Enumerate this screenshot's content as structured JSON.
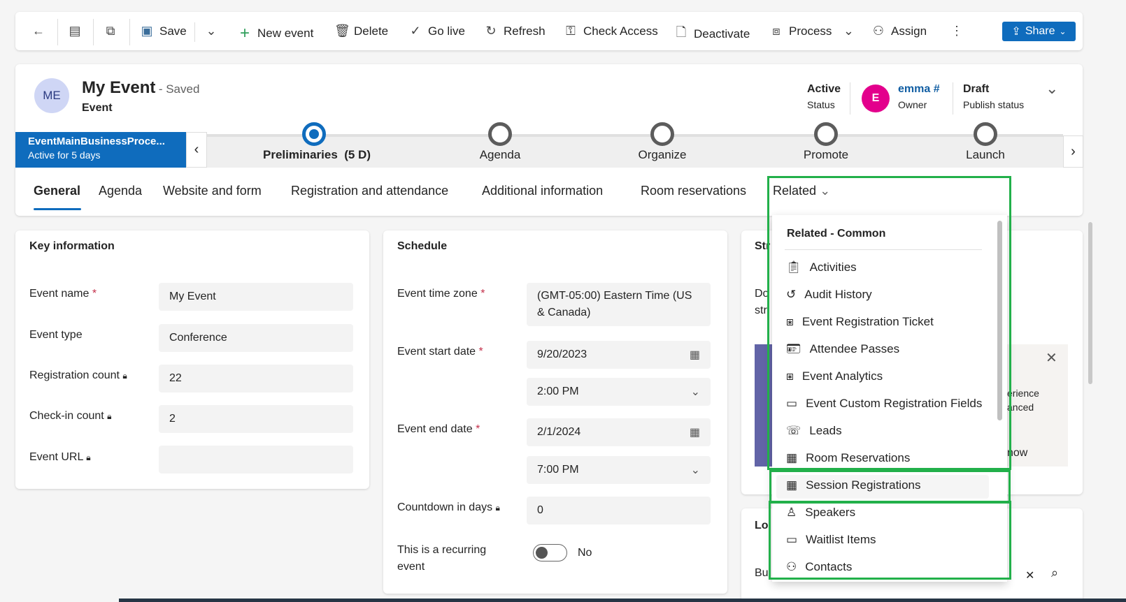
{
  "toolbar": {
    "save": "Save",
    "new_event": "New event",
    "delete": "Delete",
    "go_live": "Go live",
    "refresh": "Refresh",
    "check_access": "Check Access",
    "deactivate": "Deactivate",
    "process": "Process",
    "assign": "Assign",
    "share": "Share"
  },
  "header": {
    "avatar": "ME",
    "title": "My Event",
    "saved": "- Saved",
    "entity": "Event",
    "status_value": "Active",
    "status_label": "Status",
    "owner_avatar": "E",
    "owner_value": "emma #",
    "owner_label": "Owner",
    "publish_value": "Draft",
    "publish_label": "Publish status",
    "owner_color": "#e3008c"
  },
  "process": {
    "name": "EventMainBusinessProce...",
    "active": "Active for 5 days",
    "stages": [
      "Preliminaries  (5 D)",
      "Agenda",
      "Organize",
      "Promote",
      "Launch"
    ]
  },
  "tabs": [
    "General",
    "Agenda",
    "Website and form",
    "Registration and attendance",
    "Additional information",
    "Room reservations",
    "Related"
  ],
  "key_info": {
    "title": "Key information",
    "fields": [
      {
        "label": "Event name",
        "value": "My Event"
      },
      {
        "label": "Event type",
        "value": "Conference"
      },
      {
        "label": "Registration count",
        "value": "22"
      },
      {
        "label": "Check-in count",
        "value": "2"
      },
      {
        "label": "Event URL",
        "value": ""
      }
    ]
  },
  "schedule": {
    "title": "Schedule",
    "tz_label": "Event time zone",
    "tz_value": "(GMT-05:00) Eastern Time (US & Canada)",
    "start_label": "Event start date",
    "start_date": "9/20/2023",
    "start_time": "2:00 PM",
    "end_label": "Event end date",
    "end_date": "2/1/2024",
    "end_time": "7:00 PM",
    "countdown_label": "Countdown in days",
    "countdown_value": "0",
    "recurring_label": "This is a recurring event",
    "recurring_value": "No"
  },
  "right": {
    "title_partial": "Str",
    "text1": "Do",
    "text2": "str",
    "side1": "erience",
    "side2": "anced",
    "side3": "now",
    "loc_partial": "Lo",
    "bu_partial": "Bu"
  },
  "related_menu": {
    "header": "Related - Common",
    "items": [
      "Activities",
      "Audit History",
      "Event Registration Ticket",
      "Attendee Passes",
      "Event Analytics",
      "Event Custom Registration Fields",
      "Leads",
      "Room Reservations",
      "Session Registrations",
      "Speakers",
      "Waitlist Items",
      "Contacts"
    ]
  }
}
